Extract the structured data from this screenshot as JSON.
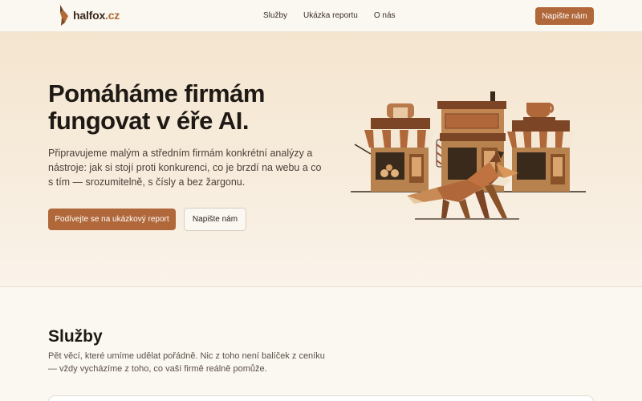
{
  "header": {
    "logo": {
      "name": "halfox",
      "tld": ".cz"
    },
    "nav": [
      {
        "label": "Služby"
      },
      {
        "label": "Ukázka reportu"
      },
      {
        "label": "O nás"
      }
    ],
    "cta_label": "Napište nám"
  },
  "hero": {
    "title_line1": "Pomáháme firmám",
    "title_line2": "fungovat v éře AI.",
    "lead": "Připravujeme malým a středním firmám konkrétní analýzy a nástroje: jak si stojí proti konkurenci, co je brzdí na webu a co s tím — srozumitelně, s čísly a bez žargonu.",
    "primary_button": "Podívejte se na ukázkový report",
    "secondary_button": "Napište nám"
  },
  "services": {
    "title": "Služby",
    "lead": "Pět věcí, které umíme udělat pořádně. Nic z toho není balíček z ceníku — vždy vycházíme z toho, co vaší firmě reálně pomůže."
  },
  "colors": {
    "accent": "#b0683a",
    "background": "#fbf7f1",
    "hero_gradient_top": "#f4e5cf",
    "text_dark": "#1e1914"
  },
  "icons": {
    "logo": "fox-logo-icon",
    "illustration": "shops-and-fox-illustration"
  }
}
